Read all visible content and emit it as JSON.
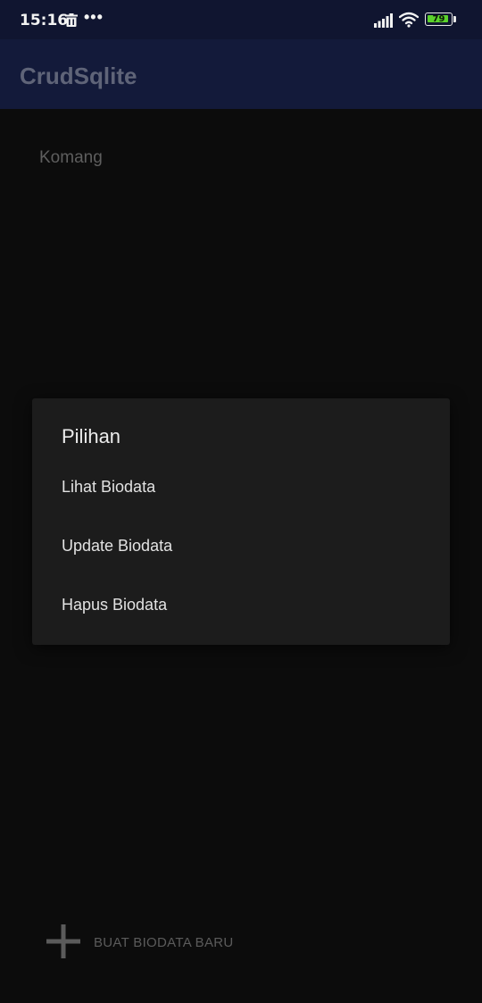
{
  "status_bar": {
    "time": "15:16",
    "more_indicator": "•••",
    "battery_level": "79",
    "icons": [
      "trash-icon",
      "signal-icon",
      "wifi-icon",
      "battery-icon"
    ]
  },
  "app_bar": {
    "title": "CrudSqlite"
  },
  "list": {
    "items": [
      {
        "label": "Komang"
      }
    ]
  },
  "dialog": {
    "title": "Pilihan",
    "options": [
      {
        "label": "Lihat Biodata"
      },
      {
        "label": "Update Biodata"
      },
      {
        "label": "Hapus Biodata"
      }
    ]
  },
  "bottom_button": {
    "label": "BUAT BIODATA BARU",
    "icon": "plus-icon"
  },
  "colors": {
    "status_bar_bg": "#101530",
    "app_bar_bg": "#131a3a",
    "background": "#0c0c0c",
    "dialog_bg": "#1c1c1c",
    "battery_fill": "#5bd22c"
  }
}
